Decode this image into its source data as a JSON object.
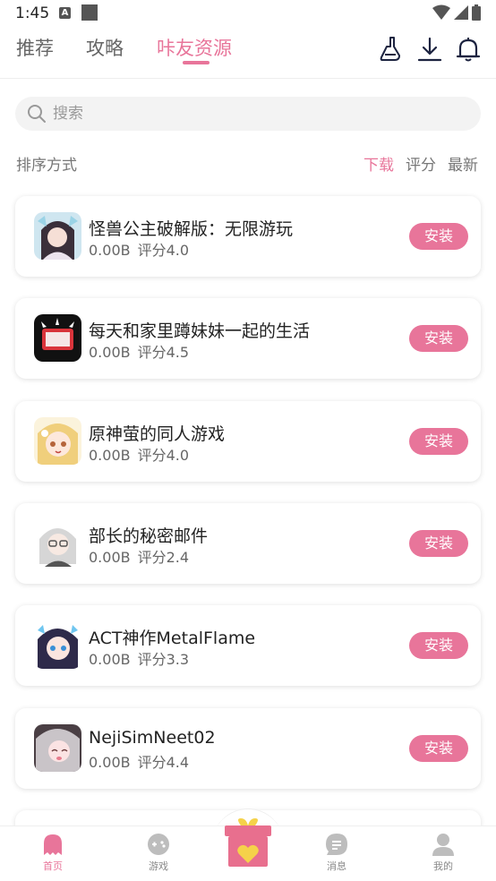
{
  "status_bar": {
    "time": "1:45",
    "notification_letter": "A"
  },
  "top_nav": {
    "tabs": [
      {
        "label": "推荐"
      },
      {
        "label": "攻略"
      },
      {
        "label": "咔友资源"
      }
    ],
    "active_tab": "咔友资源",
    "icons": [
      "broom-icon",
      "download-icon",
      "bell-icon"
    ]
  },
  "search": {
    "placeholder": "搜索"
  },
  "sort": {
    "title": "排序方式",
    "options": [
      {
        "label": "下载"
      },
      {
        "label": "评分"
      },
      {
        "label": "最新"
      }
    ],
    "active": "下载"
  },
  "apps": [
    {
      "title": "怪兽公主破解版：无限游玩",
      "size": "0.00B",
      "rating": "评分4.0",
      "action": "安装",
      "icon_color": "#c7a7c7"
    },
    {
      "title": "每天和家里蹲妹妹一起的生活",
      "size": "0.00B",
      "rating": "评分4.5",
      "action": "安装",
      "icon_color": "#222222"
    },
    {
      "title": "原神萤的同人游戏",
      "size": "0.00B",
      "rating": "评分4.0",
      "action": "安装",
      "icon_color": "#f3d98a"
    },
    {
      "title": "部长的秘密邮件",
      "size": "0.00B",
      "rating": "评分2.4",
      "action": "安装",
      "icon_color": "#d9d9d9"
    },
    {
      "title": "ACT神作MetalFlame",
      "size": "0.00B",
      "rating": "评分3.3",
      "action": "安装",
      "icon_color": "#3b3560"
    },
    {
      "title": "NejiSimNeet02",
      "size": "0.00B",
      "rating": "评分4.4",
      "action": "安装",
      "icon_color": "#8a7f86"
    }
  ],
  "bottom_nav": {
    "items": [
      {
        "label": "首页",
        "icon": "ghost-icon"
      },
      {
        "label": "游戏",
        "icon": "gamepad-icon"
      },
      {
        "label": "",
        "icon": "gift-icon"
      },
      {
        "label": "消息",
        "icon": "message-icon"
      },
      {
        "label": "我的",
        "icon": "person-icon"
      }
    ],
    "active": "首页"
  },
  "colors": {
    "accent": "#e8759a",
    "gift_box": "#e86f8e",
    "gift_heart": "#f5d24a"
  }
}
